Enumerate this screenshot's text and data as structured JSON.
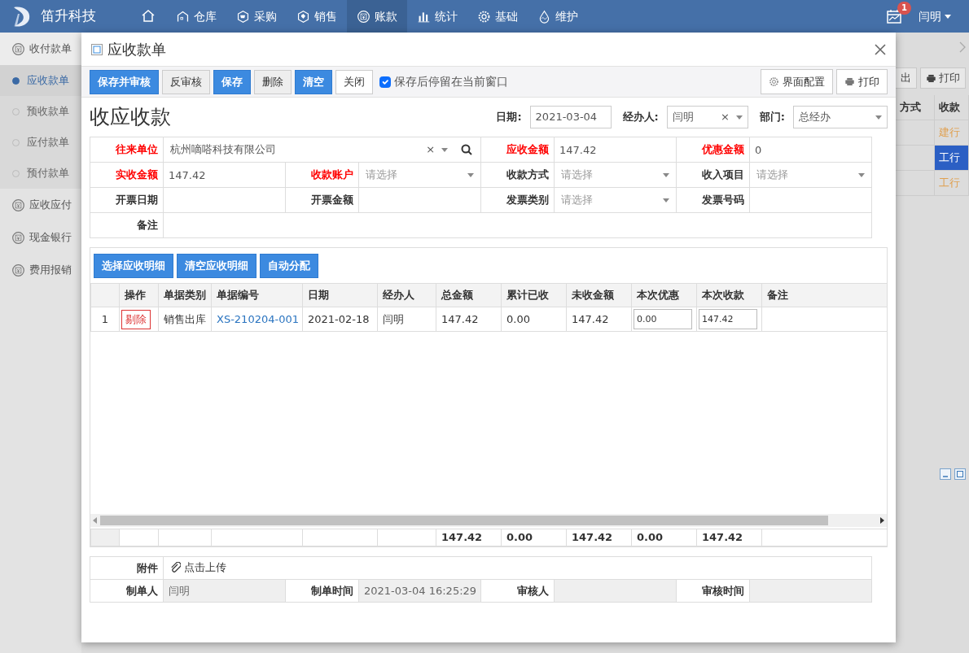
{
  "app": {
    "logo_text": "笛升科技",
    "nav": [
      {
        "selected": false
      },
      {
        "label": "仓库",
        "selected": false
      },
      {
        "label": "采购",
        "selected": false
      },
      {
        "label": "销售",
        "selected": false
      },
      {
        "label": "账款",
        "selected": true
      },
      {
        "label": "统计",
        "selected": false
      },
      {
        "label": "基础",
        "selected": false
      },
      {
        "label": "维护",
        "selected": false
      }
    ],
    "notification_count": "1",
    "user": "闫明"
  },
  "sidebar": {
    "items": [
      {
        "label": "收付款单",
        "children": [
          {
            "label": "应收款单",
            "selected": true
          },
          {
            "label": "预收款单",
            "selected": false
          },
          {
            "label": "应付款单",
            "selected": false
          },
          {
            "label": "预付款单",
            "selected": false
          }
        ]
      },
      {
        "label": "应收应付"
      },
      {
        "label": "现金银行"
      },
      {
        "label": "费用报销"
      }
    ]
  },
  "background": {
    "buttons": [
      {
        "label": "出"
      },
      {
        "label": "打印"
      }
    ],
    "columns": [
      "方式",
      "收款"
    ],
    "rows": [
      {
        "cell": "建行",
        "selected": false
      },
      {
        "cell": "工行",
        "selected": true
      },
      {
        "cell": "工行",
        "selected": false
      }
    ]
  },
  "dialog": {
    "title": "应收款单",
    "toolbar": [
      {
        "label": "保存并审核",
        "kind": "primary"
      },
      {
        "label": "反审核",
        "kind": "default"
      },
      {
        "label": "保存",
        "kind": "primary"
      },
      {
        "label": "删除",
        "kind": "default"
      },
      {
        "label": "清空",
        "kind": "primary"
      },
      {
        "label": "关闭",
        "kind": "plain"
      }
    ],
    "stay_option": {
      "label": "保存后停留在当前窗口",
      "checked": true
    },
    "right_buttons": [
      {
        "label": "界面配置"
      },
      {
        "label": "打印"
      }
    ],
    "heading": "收应收款",
    "header_fields": [
      {
        "label": "日期:",
        "kind": "text",
        "value": "2021-03-04"
      },
      {
        "label": "经办人:",
        "kind": "select",
        "value": "闫明",
        "clear": "×"
      },
      {
        "label": "部门:",
        "kind": "select",
        "value": "总经办"
      }
    ],
    "form_rows": [
      [
        {
          "label": "往来单位",
          "required": true,
          "kind": "party",
          "value": "杭州嘀嗒科技有限公司",
          "clear": "×"
        },
        {
          "label": "应收金额",
          "required": true,
          "kind": "text",
          "value": "147.42"
        },
        {
          "label": "优惠金额",
          "required": true,
          "kind": "text",
          "value": "0"
        }
      ],
      [
        {
          "label": "实收金额",
          "required": true,
          "kind": "text",
          "value": "147.42"
        },
        {
          "label": "收款账户",
          "required": true,
          "kind": "select",
          "placeholder": "请选择"
        },
        {
          "label": "收款方式",
          "required": false,
          "kind": "select",
          "placeholder": "请选择"
        },
        {
          "label": "收入项目",
          "required": false,
          "kind": "select",
          "placeholder": "请选择"
        }
      ],
      [
        {
          "label": "开票日期",
          "required": false,
          "kind": "text"
        },
        {
          "label": "开票金额",
          "required": false,
          "kind": "text"
        },
        {
          "label": "发票类别",
          "required": false,
          "kind": "select",
          "placeholder": "请选择"
        },
        {
          "label": "发票号码",
          "required": false,
          "kind": "text"
        }
      ],
      [
        {
          "label": "备注",
          "required": false,
          "kind": "text"
        }
      ]
    ],
    "detail_buttons": [
      "选择应收明细",
      "清空应收明细",
      "自动分配"
    ],
    "columns": [
      {
        "label": "操作",
        "kind": "action"
      },
      {
        "label": "单据类别",
        "kind": "text"
      },
      {
        "label": "单据编号",
        "kind": "link"
      },
      {
        "label": "日期",
        "kind": "text"
      },
      {
        "label": "经办人",
        "kind": "text"
      },
      {
        "label": "总金额",
        "kind": "text"
      },
      {
        "label": "累计已收",
        "kind": "text"
      },
      {
        "label": "未收金额",
        "kind": "text"
      },
      {
        "label": "本次优惠",
        "kind": "input"
      },
      {
        "label": "本次收款",
        "kind": "input"
      },
      {
        "label": "备注",
        "kind": "text"
      }
    ],
    "rows": [
      {
        "number": "1",
        "cells": [
          "剔除",
          "销售出库",
          "XS-210204-001",
          "2021-02-18",
          "闫明",
          "147.42",
          "0.00",
          "147.42",
          "0.00",
          "147.42"
        ]
      }
    ],
    "totals": [
      "147.42",
      "0.00",
      "147.42",
      "0.00",
      "147.42"
    ],
    "attachment": {
      "label": "附件",
      "link": "点击上传"
    },
    "audit": [
      {
        "label": "制单人",
        "value": "闫明"
      },
      {
        "label": "制单时间",
        "value": "2021-03-04 16:25:29"
      },
      {
        "label": "审核人"
      },
      {
        "label": "审核时间"
      }
    ]
  }
}
